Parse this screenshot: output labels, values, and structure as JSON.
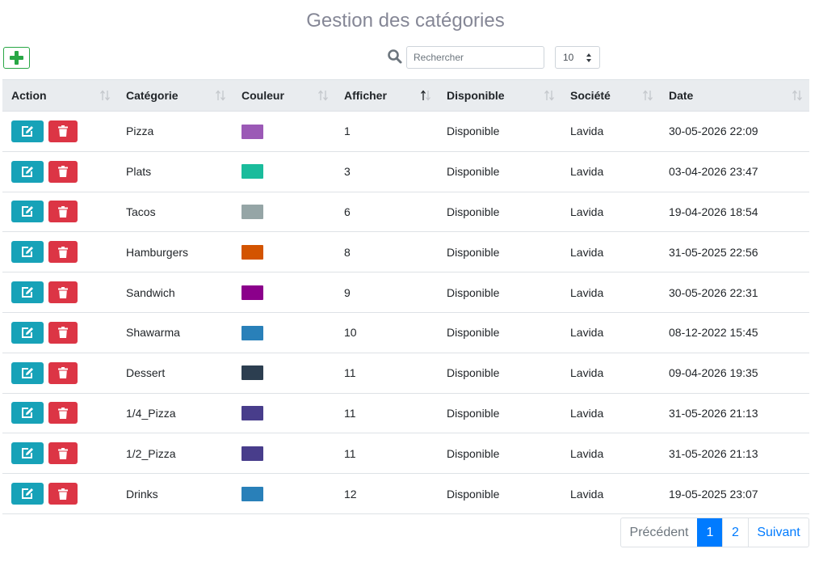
{
  "header": {
    "title": "Gestion des catégories"
  },
  "toolbar": {
    "search_placeholder": "Rechercher",
    "page_size": "10"
  },
  "table": {
    "columns": [
      {
        "key": "action",
        "label": "Action"
      },
      {
        "key": "categorie",
        "label": "Catégorie"
      },
      {
        "key": "couleur",
        "label": "Couleur"
      },
      {
        "key": "afficher",
        "label": "Afficher"
      },
      {
        "key": "disponible",
        "label": "Disponible"
      },
      {
        "key": "societe",
        "label": "Société"
      },
      {
        "key": "date",
        "label": "Date"
      }
    ],
    "sorted_column": "afficher",
    "rows": [
      {
        "categorie": "Pizza",
        "couleur": "#9b59b6",
        "afficher": "1",
        "disponible": "Disponible",
        "societe": "Lavida",
        "date": "30-05-2026 22:09"
      },
      {
        "categorie": "Plats",
        "couleur": "#1abc9c",
        "afficher": "3",
        "disponible": "Disponible",
        "societe": "Lavida",
        "date": "03-04-2026 23:47"
      },
      {
        "categorie": "Tacos",
        "couleur": "#95a5a6",
        "afficher": "6",
        "disponible": "Disponible",
        "societe": "Lavida",
        "date": "19-04-2026 18:54"
      },
      {
        "categorie": "Hamburgers",
        "couleur": "#d35400",
        "afficher": "8",
        "disponible": "Disponible",
        "societe": "Lavida",
        "date": "31-05-2025 22:56"
      },
      {
        "categorie": "Sandwich",
        "couleur": "#8b008b",
        "afficher": "9",
        "disponible": "Disponible",
        "societe": "Lavida",
        "date": "30-05-2026 22:31"
      },
      {
        "categorie": "Shawarma",
        "couleur": "#2980b9",
        "afficher": "10",
        "disponible": "Disponible",
        "societe": "Lavida",
        "date": "08-12-2022 15:45"
      },
      {
        "categorie": "Dessert",
        "couleur": "#2c3e50",
        "afficher": "11",
        "disponible": "Disponible",
        "societe": "Lavida",
        "date": "09-04-2026 19:35"
      },
      {
        "categorie": "1/4_Pizza",
        "couleur": "#483d8b",
        "afficher": "11",
        "disponible": "Disponible",
        "societe": "Lavida",
        "date": "31-05-2026 21:13"
      },
      {
        "categorie": "1/2_Pizza",
        "couleur": "#483d8b",
        "afficher": "11",
        "disponible": "Disponible",
        "societe": "Lavida",
        "date": "31-05-2026 21:13"
      },
      {
        "categorie": "Drinks",
        "couleur": "#2980b9",
        "afficher": "12",
        "disponible": "Disponible",
        "societe": "Lavida",
        "date": "19-05-2025 23:07"
      }
    ]
  },
  "pagination": {
    "prev_label": "Précédent",
    "pages": [
      "1",
      "2"
    ],
    "active_page": "1",
    "next_label": "Suivant"
  },
  "icons": {
    "add": "plus-icon",
    "search": "search-icon",
    "edit": "edit-icon",
    "delete": "trash-icon",
    "sort": "sort-icon"
  },
  "colors": {
    "add": "#28a745",
    "edit": "#17a2b8",
    "delete": "#dc3545",
    "active_page": "#007bff"
  }
}
